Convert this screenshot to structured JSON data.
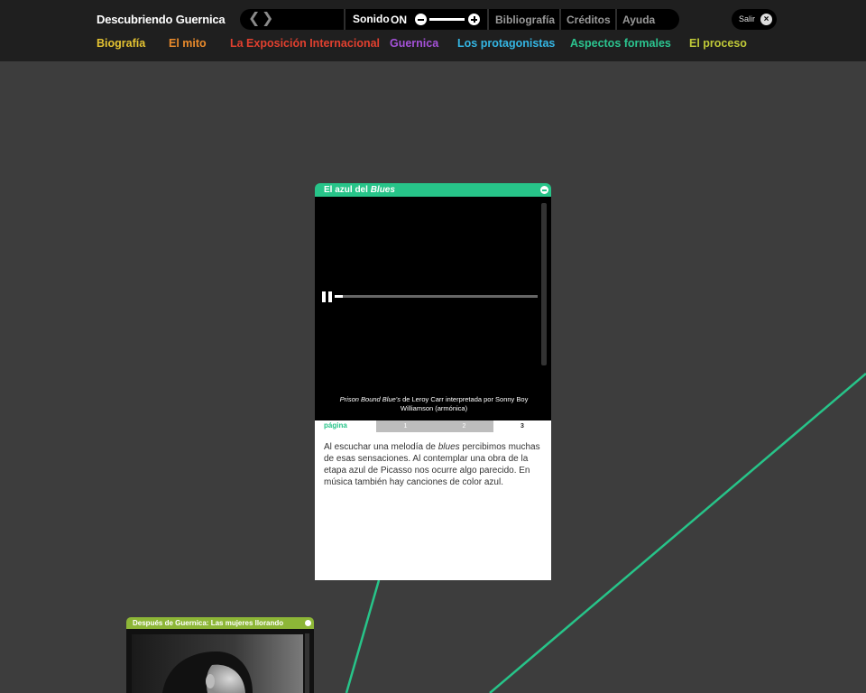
{
  "header": {
    "site_title": "Descubriendo Guernica",
    "sound_label": "Sonido",
    "sound_state": "ON",
    "sound_volume_percent": 100,
    "links": {
      "bibliografia": "Bibliografía",
      "creditos": "Créditos",
      "ayuda": "Ayuda"
    },
    "salir_label": "Salir"
  },
  "categories": [
    {
      "label": "Biografía",
      "color": "#e4c332"
    },
    {
      "label": "El mito",
      "color": "#ea8b2c"
    },
    {
      "label": "La Exposición Internacional",
      "color": "#e1402f"
    },
    {
      "label": "Guernica",
      "color": "#a552d9"
    },
    {
      "label": "Los protagonistas",
      "color": "#34b6e4"
    },
    {
      "label": "Aspectos formales",
      "color": "#2bc48f"
    },
    {
      "label": "El proceso",
      "color": "#c0c938"
    }
  ],
  "blues_panel": {
    "title_prefix": "El azul del ",
    "title_em": "Blues",
    "accent_color": "#27c489",
    "audio_progress_percent": 4,
    "caption_em": "Prison Bound Blue's",
    "caption_rest": " de Leroy Carr interpretada por Sonny Boy Williamson (armónica)",
    "pager_label": "página",
    "pages": [
      "1",
      "2",
      "3"
    ],
    "current_page": "3",
    "text_before": "Al escuchar una melodía de ",
    "text_em": "blues",
    "text_after": " percibimos muchas de esas sensaciones. Al contemplar una obra de la etapa azul de Picasso nos ocurre algo parecido. En música también hay canciones de color azul."
  },
  "mujeres_panel": {
    "title": "Después de Guernica: Las mujeres llorando",
    "accent_color": "#8db637"
  }
}
